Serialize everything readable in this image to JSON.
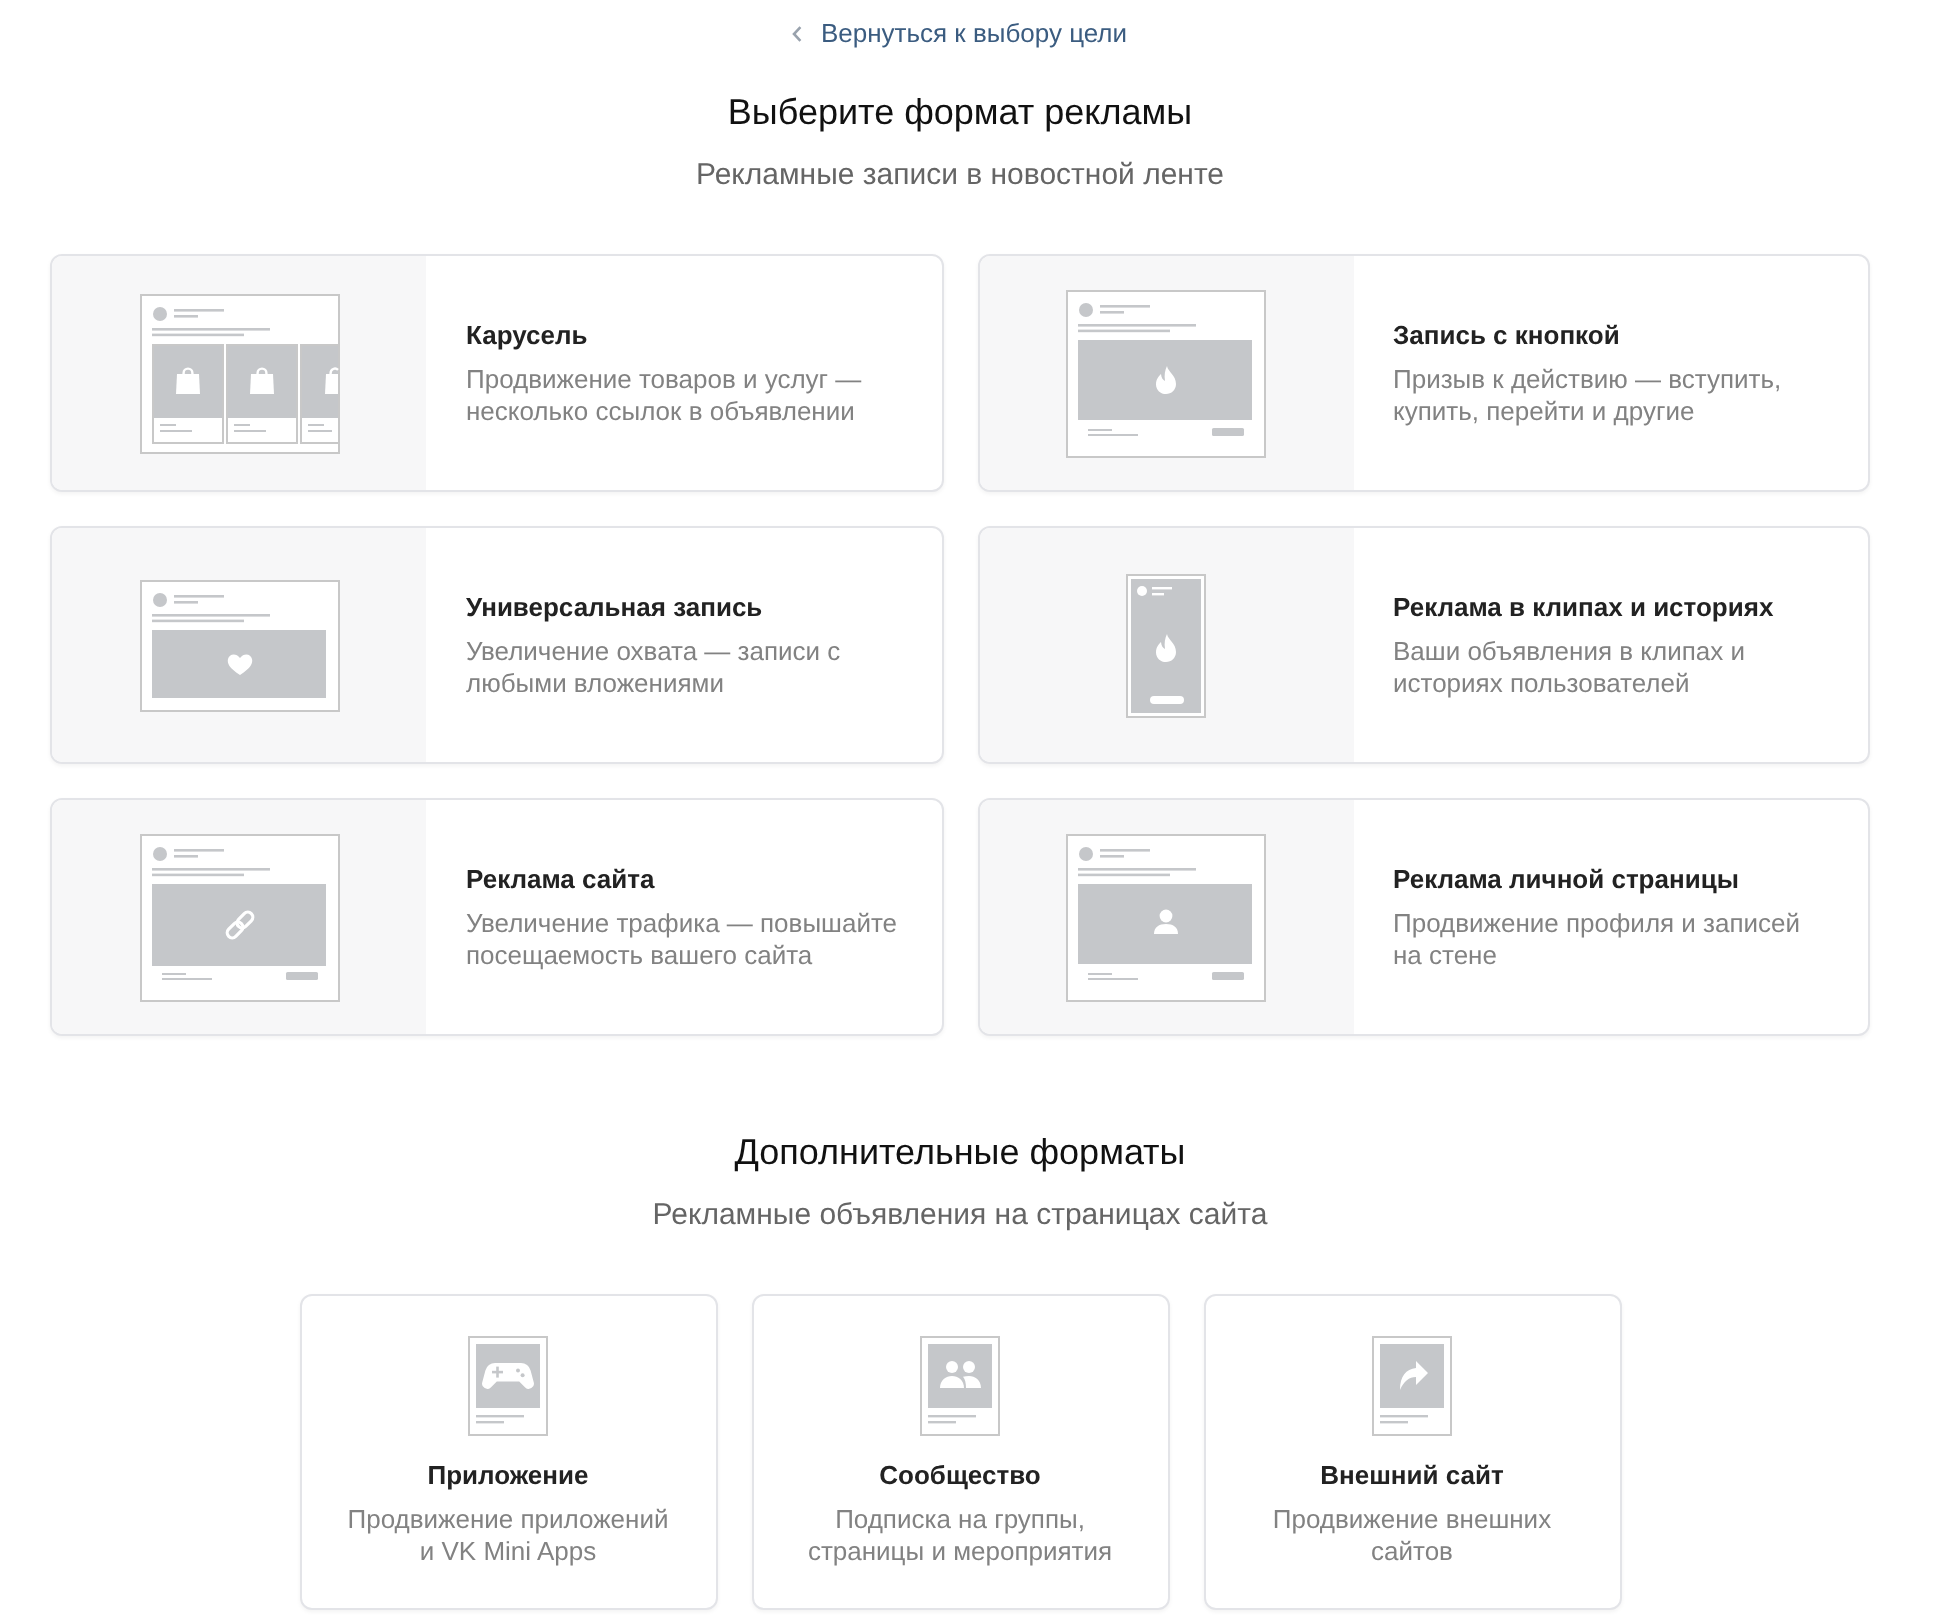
{
  "back_link": {
    "label": "Вернуться к выбору цели"
  },
  "header": {
    "title": "Выберите формат рекламы",
    "subtitle": "Рекламные записи в новостной ленте"
  },
  "formats": [
    {
      "kind": "carousel",
      "title": "Карусель",
      "description": "Продвижение товаров и услуг —\nнесколько ссылок в объявлении"
    },
    {
      "kind": "button",
      "title": "Запись с кнопкой",
      "description": "Призыв к действию — вступить,\nкупить, перейти и другие"
    },
    {
      "kind": "universal",
      "title": "Универсальная запись",
      "description": "Увеличение охвата — записи с\nлюбыми вложениями"
    },
    {
      "kind": "stories",
      "title": "Реклама в клипах и историях",
      "description": "Ваши объявления в клипах и\nисториях пользователей"
    },
    {
      "kind": "site",
      "title": "Реклама сайта",
      "description": "Увеличение трафика — повышайте\nпосещаемость вашего сайта"
    },
    {
      "kind": "profile",
      "title": "Реклама личной страницы",
      "description": "Продвижение профиля и записей\nна стене"
    }
  ],
  "extra": {
    "title": "Дополнительные форматы",
    "subtitle": "Рекламные объявления на страницах сайта"
  },
  "extra_formats": [
    {
      "kind": "app",
      "title": "Приложение",
      "description": "Продвижение приложений\nи VK Mini Apps"
    },
    {
      "kind": "community",
      "title": "Сообщество",
      "description": "Подписка на группы,\nстраницы и мероприятия"
    },
    {
      "kind": "external",
      "title": "Внешний сайт",
      "description": "Продвижение внешних\nсайтов"
    }
  ]
}
